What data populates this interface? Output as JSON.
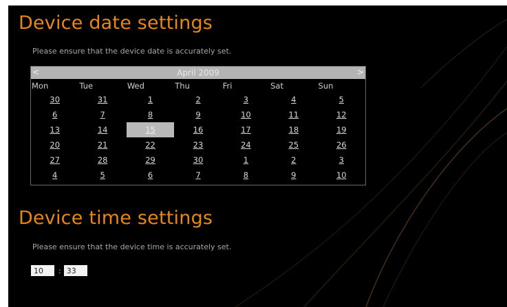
{
  "date_section": {
    "title": "Device date settings",
    "instruction": "Please ensure that the device date is accurately set."
  },
  "calendar": {
    "prev_label": "<",
    "next_label": ">",
    "month_year": "April 2009",
    "weekdays": [
      "Mon",
      "Tue",
      "Wed",
      "Thu",
      "Fri",
      "Sat",
      "Sun"
    ],
    "weeks": [
      [
        "30",
        "31",
        "1",
        "2",
        "3",
        "4",
        "5"
      ],
      [
        "6",
        "7",
        "8",
        "9",
        "10",
        "11",
        "12"
      ],
      [
        "13",
        "14",
        "15",
        "16",
        "17",
        "18",
        "19"
      ],
      [
        "20",
        "21",
        "22",
        "23",
        "24",
        "25",
        "26"
      ],
      [
        "27",
        "28",
        "29",
        "30",
        "1",
        "2",
        "3"
      ],
      [
        "4",
        "5",
        "6",
        "7",
        "8",
        "9",
        "10"
      ]
    ],
    "selected_day": "15"
  },
  "time_section": {
    "title": "Device time settings",
    "instruction": "Please ensure that the device time is accurately set.",
    "hour": "10",
    "separator": ":",
    "minute": "33"
  },
  "colors": {
    "heading": "#e8861a",
    "background": "#000000",
    "calendar_header": "#b4b4b4",
    "selected_cell": "#b9b9b9"
  }
}
